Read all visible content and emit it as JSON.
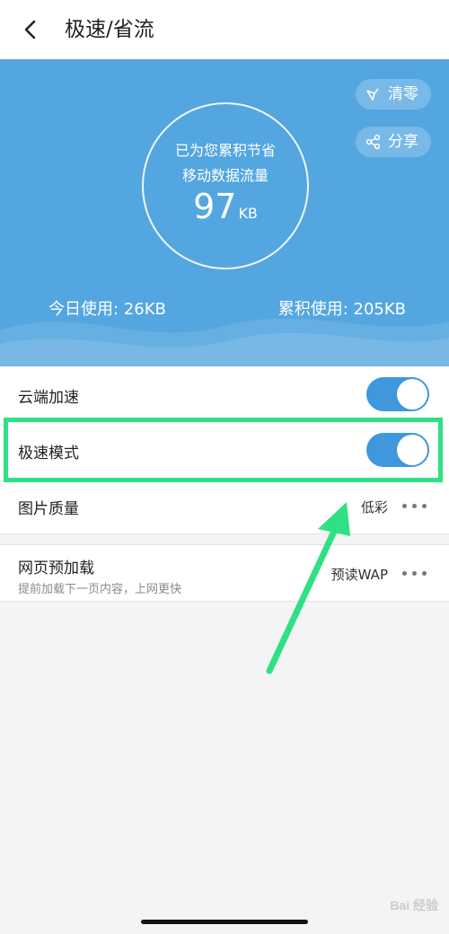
{
  "header": {
    "title": "极速/省流",
    "back_icon": "chevron-left-icon"
  },
  "hero": {
    "bg_color": "#54a6e0",
    "line1": "已为您累积节省",
    "line2": "移动数据流量",
    "value": "97",
    "unit": "KB",
    "clear_label": "清零",
    "share_label": "分享",
    "today_usage": "今日使用: 26KB",
    "total_usage": "累积使用: 205KB"
  },
  "settings": {
    "cloud_accel": {
      "label": "云端加速",
      "enabled": true
    },
    "speed_mode": {
      "label": "极速模式",
      "enabled": true
    },
    "image_quality": {
      "label": "图片质量",
      "value": "低彩"
    },
    "preload": {
      "label": "网页预加载",
      "sub": "提前加载下一页内容，上网更快",
      "value": "预读WAP"
    }
  },
  "annotation": {
    "highlight_color": "#2fe085"
  },
  "watermark": "Bai 经验"
}
